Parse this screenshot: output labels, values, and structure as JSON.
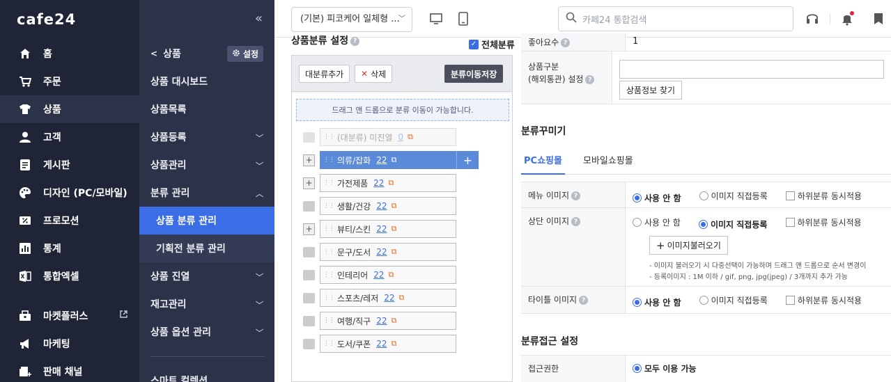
{
  "brand": {
    "logo": "cafe24",
    "collapse_icon": "«"
  },
  "main_nav": [
    {
      "label": "홈",
      "icon": "home-icon",
      "active": false
    },
    {
      "label": "주문",
      "icon": "cart-icon",
      "active": false
    },
    {
      "label": "상품",
      "icon": "shirt-icon",
      "active": true
    },
    {
      "label": "고객",
      "icon": "person-icon",
      "active": false
    },
    {
      "label": "게시판",
      "icon": "board-icon",
      "active": false
    },
    {
      "label": "디자인 (PC/모바일)",
      "icon": "palette-icon",
      "active": false
    },
    {
      "label": "프로모션",
      "icon": "coupon-icon",
      "active": false
    },
    {
      "label": "통계",
      "icon": "stats-icon",
      "active": false
    },
    {
      "label": "통합엑셀",
      "icon": "excel-icon",
      "active": false
    },
    {
      "label": "마켓플러스",
      "icon": "store-icon",
      "active": false,
      "external": true
    },
    {
      "label": "마케팅",
      "icon": "megaphone-icon",
      "active": false
    },
    {
      "label": "판매 채널",
      "icon": "channel-icon",
      "active": false
    }
  ],
  "sub_nav": {
    "back_label": "상품",
    "settings_label": "설정",
    "items": [
      {
        "label": "상품 대시보드",
        "chevron": false
      },
      {
        "label": "상품목록",
        "chevron": false
      },
      {
        "label": "상품등록",
        "chevron": true
      },
      {
        "label": "상품관리",
        "chevron": true
      },
      {
        "label": "분류 관리",
        "chevron": true,
        "expanded": true
      },
      {
        "label": "상품 분류 관리",
        "sub": true,
        "active": true
      },
      {
        "label": "기획전 분류 관리",
        "sub": true
      },
      {
        "label": "상품 진열",
        "chevron": true
      },
      {
        "label": "재고관리",
        "chevron": true
      },
      {
        "label": "상품 옵션 관리",
        "chevron": true
      },
      {
        "label": "스마트 컬렉션",
        "chevron": false
      }
    ]
  },
  "topbar": {
    "shop_select": "(기본) 피코케어 일체형 ...",
    "search_placeholder": "카페24 통합검색"
  },
  "category_panel": {
    "title": "상품분류 설정",
    "all_label": "전체분류",
    "add_button": "대분류추가",
    "delete_button": "삭제",
    "save_button": "분류이동저장",
    "dnd_hint": "드래그 앤 드롭으로 분류 이동이 가능합니다.",
    "nodes": [
      {
        "label": "(대분류) 미진열",
        "count": "0",
        "state": "hidden",
        "toggle": "none"
      },
      {
        "label": "의류/잡화",
        "count": "22",
        "state": "selected",
        "toggle": "plus"
      },
      {
        "label": "가전제품",
        "count": "22",
        "state": "normal",
        "toggle": "plus"
      },
      {
        "label": "생활/건강",
        "count": "22",
        "state": "normal",
        "toggle": "folder"
      },
      {
        "label": "뷰티/스킨",
        "count": "22",
        "state": "normal",
        "toggle": "plus"
      },
      {
        "label": "문구/도서",
        "count": "22",
        "state": "normal",
        "toggle": "folder"
      },
      {
        "label": "인테리어",
        "count": "22",
        "state": "normal",
        "toggle": "folder"
      },
      {
        "label": "스포츠/레저",
        "count": "22",
        "state": "normal",
        "toggle": "folder"
      },
      {
        "label": "여행/직구",
        "count": "22",
        "state": "normal",
        "toggle": "folder"
      },
      {
        "label": "도서/쿠폰",
        "count": "22",
        "state": "normal",
        "toggle": "folder"
      }
    ]
  },
  "right": {
    "likes_label": "좋아요수",
    "likes_value": "1",
    "product_type_label_1": "상품구분",
    "product_type_label_2": "(해외통관) 설정",
    "find_button": "상품정보 찾기",
    "decor_title": "분류꾸미기",
    "tab_pc": "PC쇼핑몰",
    "tab_mobile": "모바일쇼핑몰",
    "menu_image_label": "메뉴 이미지",
    "top_image_label": "상단 이미지",
    "title_image_label": "타이틀 이미지",
    "opt_none": "사용 안 함",
    "opt_direct": "이미지 직접등록",
    "opt_sub": "하위분류 동시적용",
    "load_image_button": "이미지불러오기",
    "note_1": "- 이미지 불러오기 시 다중선택이 가능하며 드래그 앤 드롭으로 순서 변경이",
    "note_2": "- 등록이미지 : 1M 이하 / gif, png, jpg(jpeg) / 3개까지 추가 가능",
    "access_title": "분류접근 설정",
    "access_label": "접근권한",
    "access_value": "모두 이용 가능"
  },
  "colors": {
    "sidebar": "#1f2437",
    "subnav": "#2c3248",
    "accent": "#3b6ee6",
    "selected_node": "#5b8ad8"
  }
}
